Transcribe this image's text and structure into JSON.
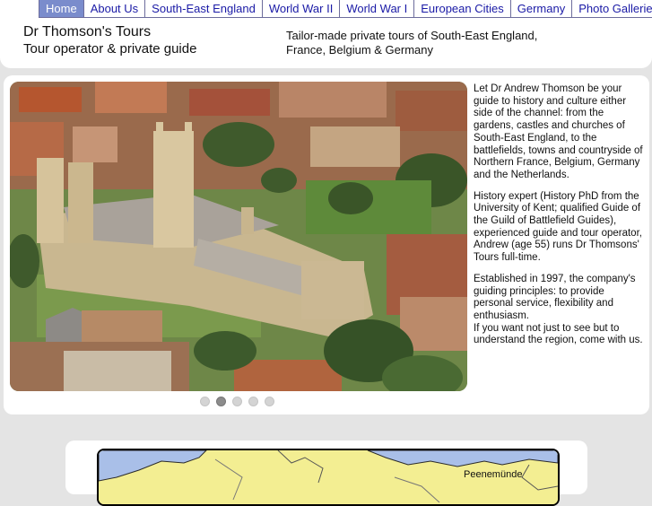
{
  "nav": {
    "items": [
      {
        "label": "Home",
        "active": true
      },
      {
        "label": "About Us"
      },
      {
        "label": "South-East England"
      },
      {
        "label": "World War II"
      },
      {
        "label": "World War I"
      },
      {
        "label": "European Cities"
      },
      {
        "label": "Germany"
      },
      {
        "label": "Photo Galleries"
      }
    ]
  },
  "header": {
    "title": "Dr Thomson's Tours",
    "subtitle": "Tour operator & private guide",
    "tagline_line1": "Tailor-made private tours of South-East England,",
    "tagline_line2": "France, Belgium & Germany"
  },
  "intro": {
    "p1": "Let Dr Andrew Thomson be your guide to history and culture either side of the channel: from the gardens, castles and churches of South-East England, to the battlefields, towns and countryside of Northern France, Belgium, Germany and the Netherlands.",
    "p2": "History expert (History PhD from the University of Kent; qualified Guide of the Guild of Battlefield Guides), experienced guide and tour operator, Andrew (age 55) runs Dr Thomsons' Tours full-time.",
    "p3": "Established in 1997, the company's guiding principles: to provide personal service, flexibility and enthusiasm.",
    "p4": "If you want not just to see but to understand the region, come with us."
  },
  "slideshow": {
    "slide_count": 5,
    "active_index": 1
  },
  "map": {
    "place_label": "Peenemünde"
  },
  "colors": {
    "nav_link": "#1a1aa6",
    "nav_active_bg": "#7a8ccc",
    "page_bg": "#e4e4e4",
    "map_land": "#f3ee92",
    "map_sea": "#a9bfe8"
  }
}
